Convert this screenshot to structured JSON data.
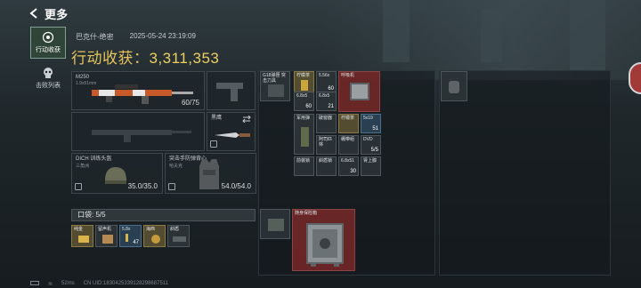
{
  "topbar": {
    "title": "更多"
  },
  "sidebar": {
    "items": [
      {
        "label": "行动收获",
        "active": true
      },
      {
        "label": "击败列表",
        "active": false
      }
    ]
  },
  "header": {
    "map": "巴克什-绝密",
    "timestamp": "2025-05-24 23:19:09",
    "harvest_label": "行动收获：",
    "harvest_value": "3,311,353"
  },
  "weapon_primary": {
    "name": "M250",
    "sub": "1.9x51mm",
    "ammo": "60/75"
  },
  "melee": {
    "name": "黑鹰"
  },
  "helmet": {
    "name": "DICH 训练头盔",
    "sub": "三角洲",
    "durability": "35.0/35.0"
  },
  "armor": {
    "name": "突击手防弹背心",
    "sub": "哈夫克",
    "durability": "54.0/54.0"
  },
  "pocket": {
    "label": "口袋: 5/5"
  },
  "pocket_items": [
    {
      "label": "纯金"
    },
    {
      "label": "留声机"
    },
    {
      "label": "5.8x",
      "count": "47"
    },
    {
      "label": "海西"
    },
    {
      "label": "斜盾"
    }
  ],
  "grid_items": [
    {
      "label": "G18弹匣 突击刀具",
      "color": "dark"
    },
    {
      "label": "柠檬茶",
      "color": "gold"
    },
    {
      "label": "5.56x",
      "count": "60",
      "color": "dark"
    },
    {
      "label": "呼吸机",
      "color": "red"
    },
    {
      "label": "6.8x5",
      "count": "60",
      "color": "dark"
    },
    {
      "label": "6.8x5",
      "count": "21",
      "color": "dark"
    },
    {
      "label": "军用弹",
      "color": "dark"
    },
    {
      "label": "破窗器",
      "color": "dark"
    },
    {
      "label": "柠檬茶",
      "color": "gold"
    },
    {
      "label": "5x19",
      "count": "51",
      "color": "blue"
    },
    {
      "label": "阿司匹林",
      "color": "dark"
    },
    {
      "label": "绷带组",
      "color": "dark"
    },
    {
      "label": "DVD",
      "count": "5/5",
      "color": "dark"
    },
    {
      "label": "前装锁",
      "color": "dark"
    },
    {
      "label": "斜盾锁",
      "color": "dark"
    },
    {
      "label": "6.8x51",
      "count": "30",
      "color": "dark"
    },
    {
      "label": "肾上腺",
      "color": "dark"
    }
  ],
  "bag_small": {
    "label": ""
  },
  "vault": {
    "label": "随身保险箱"
  },
  "footer": {
    "ping": "52ms",
    "uid": "CN UID:1830425339128298687511"
  }
}
